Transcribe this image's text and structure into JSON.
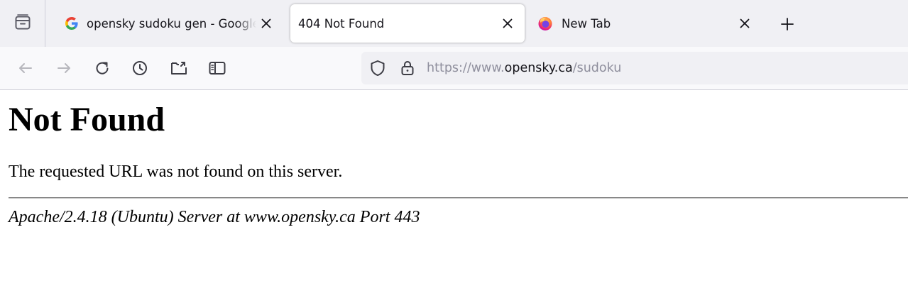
{
  "browser": {
    "tabs": [
      {
        "title": "opensky sudoku gen - Google Search",
        "favicon": "google-icon",
        "active": false
      },
      {
        "title": "404 Not Found",
        "favicon": "none",
        "active": true
      },
      {
        "title": "New Tab",
        "favicon": "firefox-icon",
        "active": false
      }
    ],
    "url": {
      "prefix": "https://www.",
      "domain": "opensky.ca",
      "path": "/sudoku"
    },
    "toolbar_icons": [
      "back-icon",
      "forward-icon",
      "reload-icon",
      "history-icon",
      "export-icon",
      "sidebar-icon"
    ],
    "colors": {
      "tabstrip_bg": "#f0f0f4",
      "toolbar_bg": "#f9f9fb",
      "urlbar_bg": "#f0f0f4",
      "text_primary": "#15141a",
      "text_dim": "#8f8f9d"
    }
  },
  "page": {
    "heading": "Not Found",
    "message": "The requested URL was not found on this server.",
    "address": "Apache/2.4.18 (Ubuntu) Server at www.opensky.ca Port 443"
  }
}
